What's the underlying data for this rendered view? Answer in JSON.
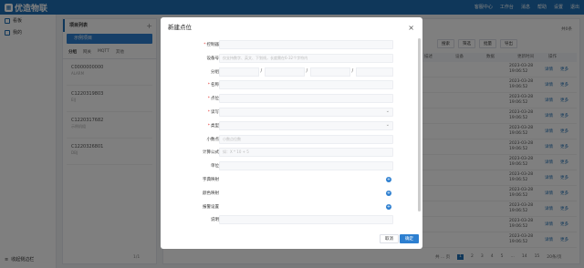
{
  "app": {
    "name": "优造物联"
  },
  "topnav": [
    "客服中心",
    "工作台",
    "消息",
    "帮助",
    "设置",
    "退出"
  ],
  "sidebar": {
    "items": [
      {
        "label": "看板"
      },
      {
        "label": "我的"
      }
    ],
    "footer": "收起侧边栏"
  },
  "project_panel": {
    "title": "项目列表",
    "group": "示例项目",
    "tabs": [
      "分组",
      "网关",
      "MQTT",
      "其他"
    ],
    "devices": [
      {
        "code": "C0000000000",
        "name": "ALARM"
      },
      {
        "code": "C1220319803",
        "name": "EIJ"
      },
      {
        "code": "C1220317682",
        "name": "示例机组"
      },
      {
        "code": "C1220326801",
        "name": "DBJ"
      }
    ],
    "pager": "1/1"
  },
  "main": {
    "info": "共0条",
    "tools": [
      "搜索",
      "筛选",
      "批量",
      "导出"
    ],
    "columns": [
      "描述",
      "设备",
      "数据",
      "更新时间",
      "操作"
    ],
    "rows": [
      {
        "date": "2023-03-28",
        "time": "19:06:52"
      },
      {
        "date": "2023-03-28",
        "time": "19:06:52"
      },
      {
        "date": "2023-03-28",
        "time": "19:06:52"
      },
      {
        "date": "2023-03-28",
        "time": "19:06:52"
      },
      {
        "date": "2023-03-28",
        "time": "19:06:52"
      },
      {
        "date": "2023-03-28",
        "time": "19:06:52"
      },
      {
        "date": "2023-03-28",
        "time": "19:06:52"
      },
      {
        "date": "2023-03-28",
        "time": "19:06:52"
      },
      {
        "date": "2023-03-28",
        "time": "19:06:52"
      },
      {
        "date": "2023-03-28",
        "time": "19:06:52"
      },
      {
        "date": "2023-03-28",
        "time": "19:06:52"
      },
      {
        "date": "2023-03-28",
        "time": "19:06:52"
      }
    ],
    "row_actions": [
      "详情",
      "更多"
    ],
    "pager": [
      "共 ... 页",
      "1",
      "2",
      "3",
      "4",
      "5",
      "...",
      "14",
      "15",
      "20条/页"
    ]
  },
  "modal": {
    "title": "新建点位",
    "close": "×",
    "fields": [
      {
        "label": "控制器",
        "required": true,
        "placeholder": ""
      },
      {
        "label": "设备号",
        "required": false,
        "placeholder": "仅支持数字、英文、下划线，长度需在6-32个字符内"
      },
      {
        "label": "分组",
        "required": false,
        "type": "group"
      },
      {
        "label": "名称",
        "required": true,
        "placeholder": ""
      },
      {
        "label": "点位",
        "required": true,
        "placeholder": ""
      },
      {
        "label": "读写",
        "required": true,
        "type": "select"
      },
      {
        "label": "类型",
        "required": true,
        "type": "select"
      },
      {
        "label": "小数点",
        "required": false,
        "placeholder": "小数点位数"
      },
      {
        "label": "计算公式",
        "required": false,
        "placeholder": "如：X * 10 + 5"
      },
      {
        "label": "单位",
        "required": false,
        "placeholder": ""
      },
      {
        "label": "字典映射",
        "required": false,
        "type": "add"
      },
      {
        "label": "颜色映射",
        "required": false,
        "type": "add"
      },
      {
        "label": "报警设置",
        "required": false,
        "type": "add"
      },
      {
        "label": "说明",
        "required": false,
        "placeholder": ""
      }
    ],
    "cancel": "取消",
    "confirm": "确定"
  },
  "colors": {
    "primary": "#1f6fb4",
    "accent": "#2d7fd0",
    "required": "#e53935"
  }
}
